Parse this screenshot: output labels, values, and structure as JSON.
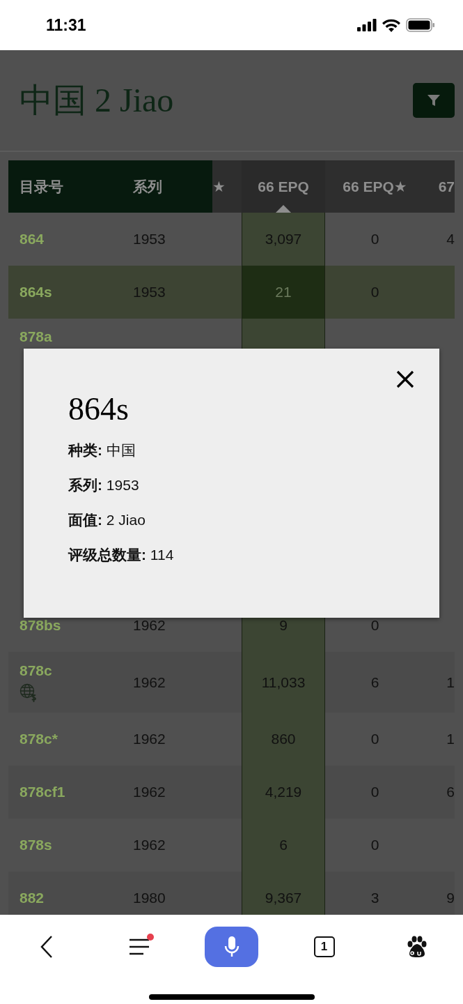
{
  "status_bar": {
    "time": "11:31"
  },
  "page": {
    "title": "中国 2 Jiao"
  },
  "table": {
    "columns": [
      {
        "label": "目录号",
        "frozen": true,
        "sorted": false
      },
      {
        "label": "系列",
        "frozen": true,
        "sorted": false
      },
      {
        "label": "★",
        "frozen": false,
        "sorted": false
      },
      {
        "label": "66 EPQ",
        "frozen": false,
        "sorted": true
      },
      {
        "label": "66 EPQ★",
        "frozen": false,
        "sorted": false
      },
      {
        "label": "67",
        "frozen": false,
        "sorted": false
      }
    ],
    "rows_top": [
      {
        "catalog": "864",
        "series": "1953",
        "epq": "3,097",
        "epq_star": "0",
        "col_6": "4",
        "selected": false,
        "globe_icon": false
      },
      {
        "catalog": "864s",
        "series": "1953",
        "epq": "21",
        "epq_star": "0",
        "selected": true,
        "globe_icon": false
      },
      {
        "catalog": "878a",
        "selected": false,
        "globe_icon": false
      }
    ],
    "rows_bottom": [
      {
        "catalog": "878bs",
        "series": "1962",
        "epq": "9",
        "epq_star": "0",
        "selected": false,
        "globe_icon": false
      },
      {
        "catalog": "878c",
        "series": "1962",
        "epq": "11,033",
        "epq_star": "6",
        "col_6": "1",
        "selected": false,
        "globe_icon": true
      },
      {
        "catalog": "878c*",
        "series": "1962",
        "epq": "860",
        "epq_star": "0",
        "col_6": "1",
        "selected": false,
        "globe_icon": false
      },
      {
        "catalog": "878cf1",
        "series": "1962",
        "epq": "4,219",
        "epq_star": "0",
        "col_6": "6",
        "selected": false,
        "globe_icon": false
      },
      {
        "catalog": "878s",
        "series": "1962",
        "epq": "6",
        "epq_star": "0",
        "selected": false,
        "globe_icon": false
      },
      {
        "catalog": "882",
        "series": "1980",
        "epq": "9,367",
        "epq_star": "3",
        "col_6": "9",
        "selected": false,
        "globe_icon": false
      }
    ]
  },
  "dialog": {
    "title": "864s",
    "fields": [
      {
        "label": "种类:",
        "value": "中国"
      },
      {
        "label": "系列:",
        "value": "1953"
      },
      {
        "label": "面值:",
        "value": "2 Jiao"
      },
      {
        "label": "评级总数量:",
        "value": "114"
      }
    ]
  },
  "bottom_nav": {
    "menu_badge": true,
    "tab_count": "1"
  }
}
